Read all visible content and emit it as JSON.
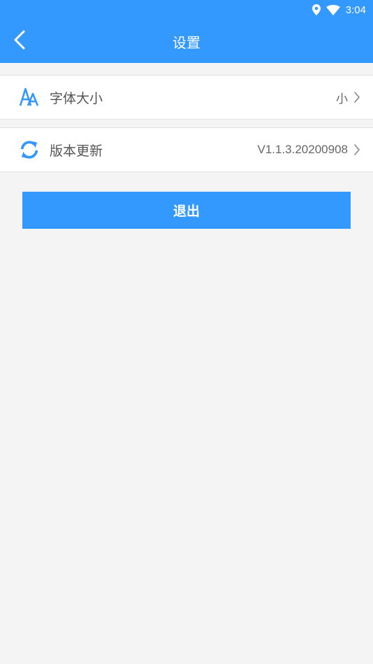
{
  "status_bar": {
    "time": "3:04",
    "icons": [
      "location-icon",
      "wifi-icon"
    ]
  },
  "app_bar": {
    "title": "设置",
    "back_icon": "chevron-left-icon"
  },
  "settings": {
    "items": [
      {
        "icon": "font-size-icon",
        "label": "字体大小",
        "value": "小"
      },
      {
        "icon": "refresh-icon",
        "label": "版本更新",
        "value": "V1.1.3.20200908"
      }
    ]
  },
  "logout_button": {
    "label": "退出"
  },
  "colors": {
    "primary": "#3399ff",
    "background": "#f4f4f4",
    "row_background": "#ffffff",
    "label_text": "#555555"
  }
}
